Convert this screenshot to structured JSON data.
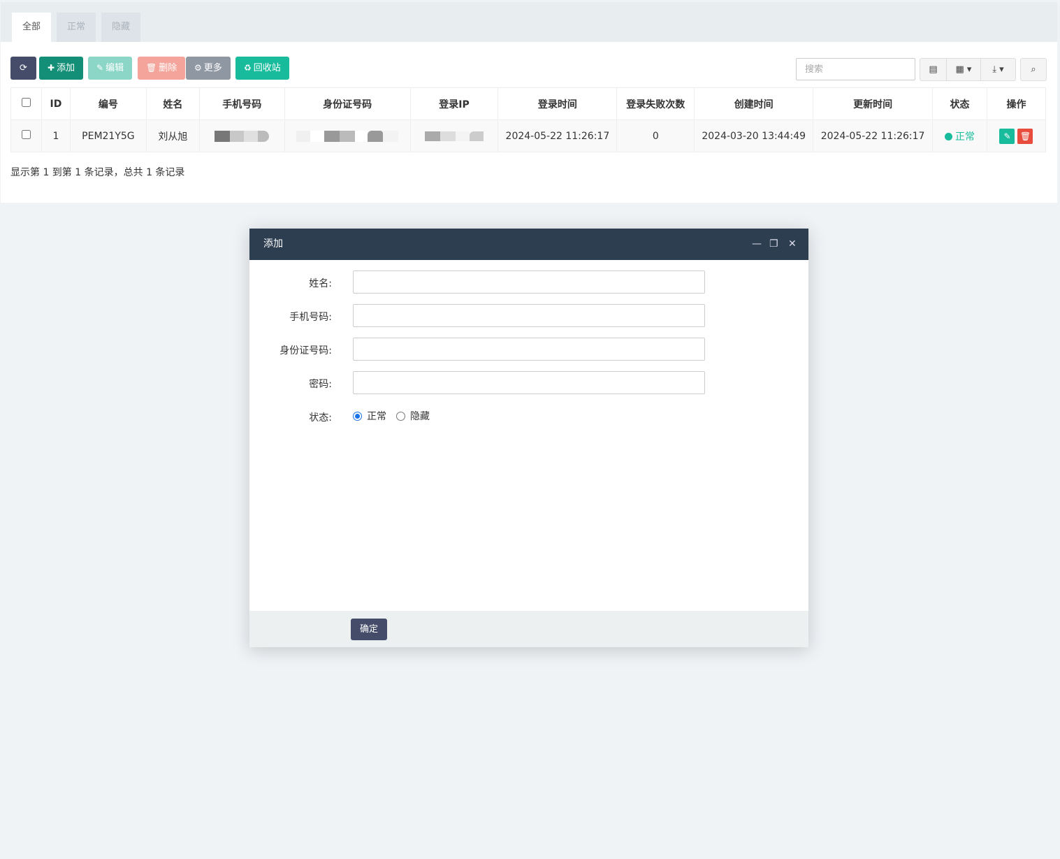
{
  "tabs": [
    {
      "label": "全部",
      "active": true
    },
    {
      "label": "正常",
      "active": false
    },
    {
      "label": "隐藏",
      "active": false
    }
  ],
  "toolbar": {
    "add": "添加",
    "edit": "编辑",
    "delete": "删除",
    "more": "更多",
    "recycle": "回收站"
  },
  "search": {
    "placeholder": "搜索"
  },
  "table": {
    "headers": [
      "ID",
      "编号",
      "姓名",
      "手机号码",
      "身份证号码",
      "登录IP",
      "登录时间",
      "登录失败次数",
      "创建时间",
      "更新时间",
      "状态",
      "操作"
    ],
    "rows": [
      {
        "id": "1",
        "code": "PEM21Y5G",
        "name": "刘从旭",
        "phone": "",
        "idcard": "",
        "ip": "",
        "login_time": "2024-05-22 11:26:17",
        "fail_count": "0",
        "created": "2024-03-20 13:44:49",
        "updated": "2024-05-22 11:26:17",
        "status": "正常"
      }
    ]
  },
  "pagination": {
    "info": "显示第 1 到第 1 条记录，总共 1 条记录"
  },
  "modal": {
    "title": "添加",
    "fields": {
      "name": "姓名:",
      "phone": "手机号码:",
      "idcard": "身份证号码:",
      "password": "密码:",
      "status": "状态:"
    },
    "status_options": [
      "正常",
      "隐藏"
    ],
    "submit": "确定"
  },
  "colors": {
    "primary": "#18bc9c",
    "dark": "#2c3e50",
    "danger": "#e74c3c",
    "navy": "#444c69"
  }
}
